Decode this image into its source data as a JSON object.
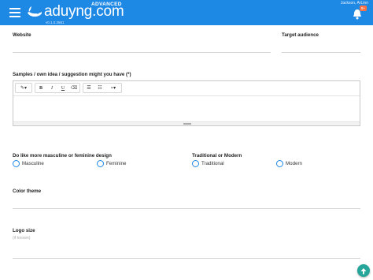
{
  "header": {
    "brand": "aduyng.com",
    "edition": "ADVANCED",
    "version": "v0.1.0.2561",
    "username": "Jackson, ArLinn",
    "notification_count": "9+"
  },
  "form": {
    "website_label": "Website",
    "target_audience_label": "Target audience",
    "samples_label": "Samples / own idea / suggestion might you have (*)",
    "design_label": "Do like more masculine or feminine design",
    "design_options": [
      "Masculine",
      "Feminine"
    ],
    "style_label": "Traditional or Modern",
    "style_options": [
      "Traditional",
      "Modern"
    ],
    "color_theme_label": "Color theme",
    "logo_size_label": "Logo size",
    "logo_size_hint": "(if known)"
  },
  "editor_toolbar": {
    "style_icon": "magic-wand-icon",
    "buttons": [
      "B",
      "I",
      "U"
    ],
    "list_icons": [
      "unordered-list-icon",
      "ordered-list-icon",
      "align-icon"
    ]
  },
  "colors": {
    "primary": "#1e88e5",
    "fab": "#26a69a",
    "badge": "#ff7043"
  }
}
